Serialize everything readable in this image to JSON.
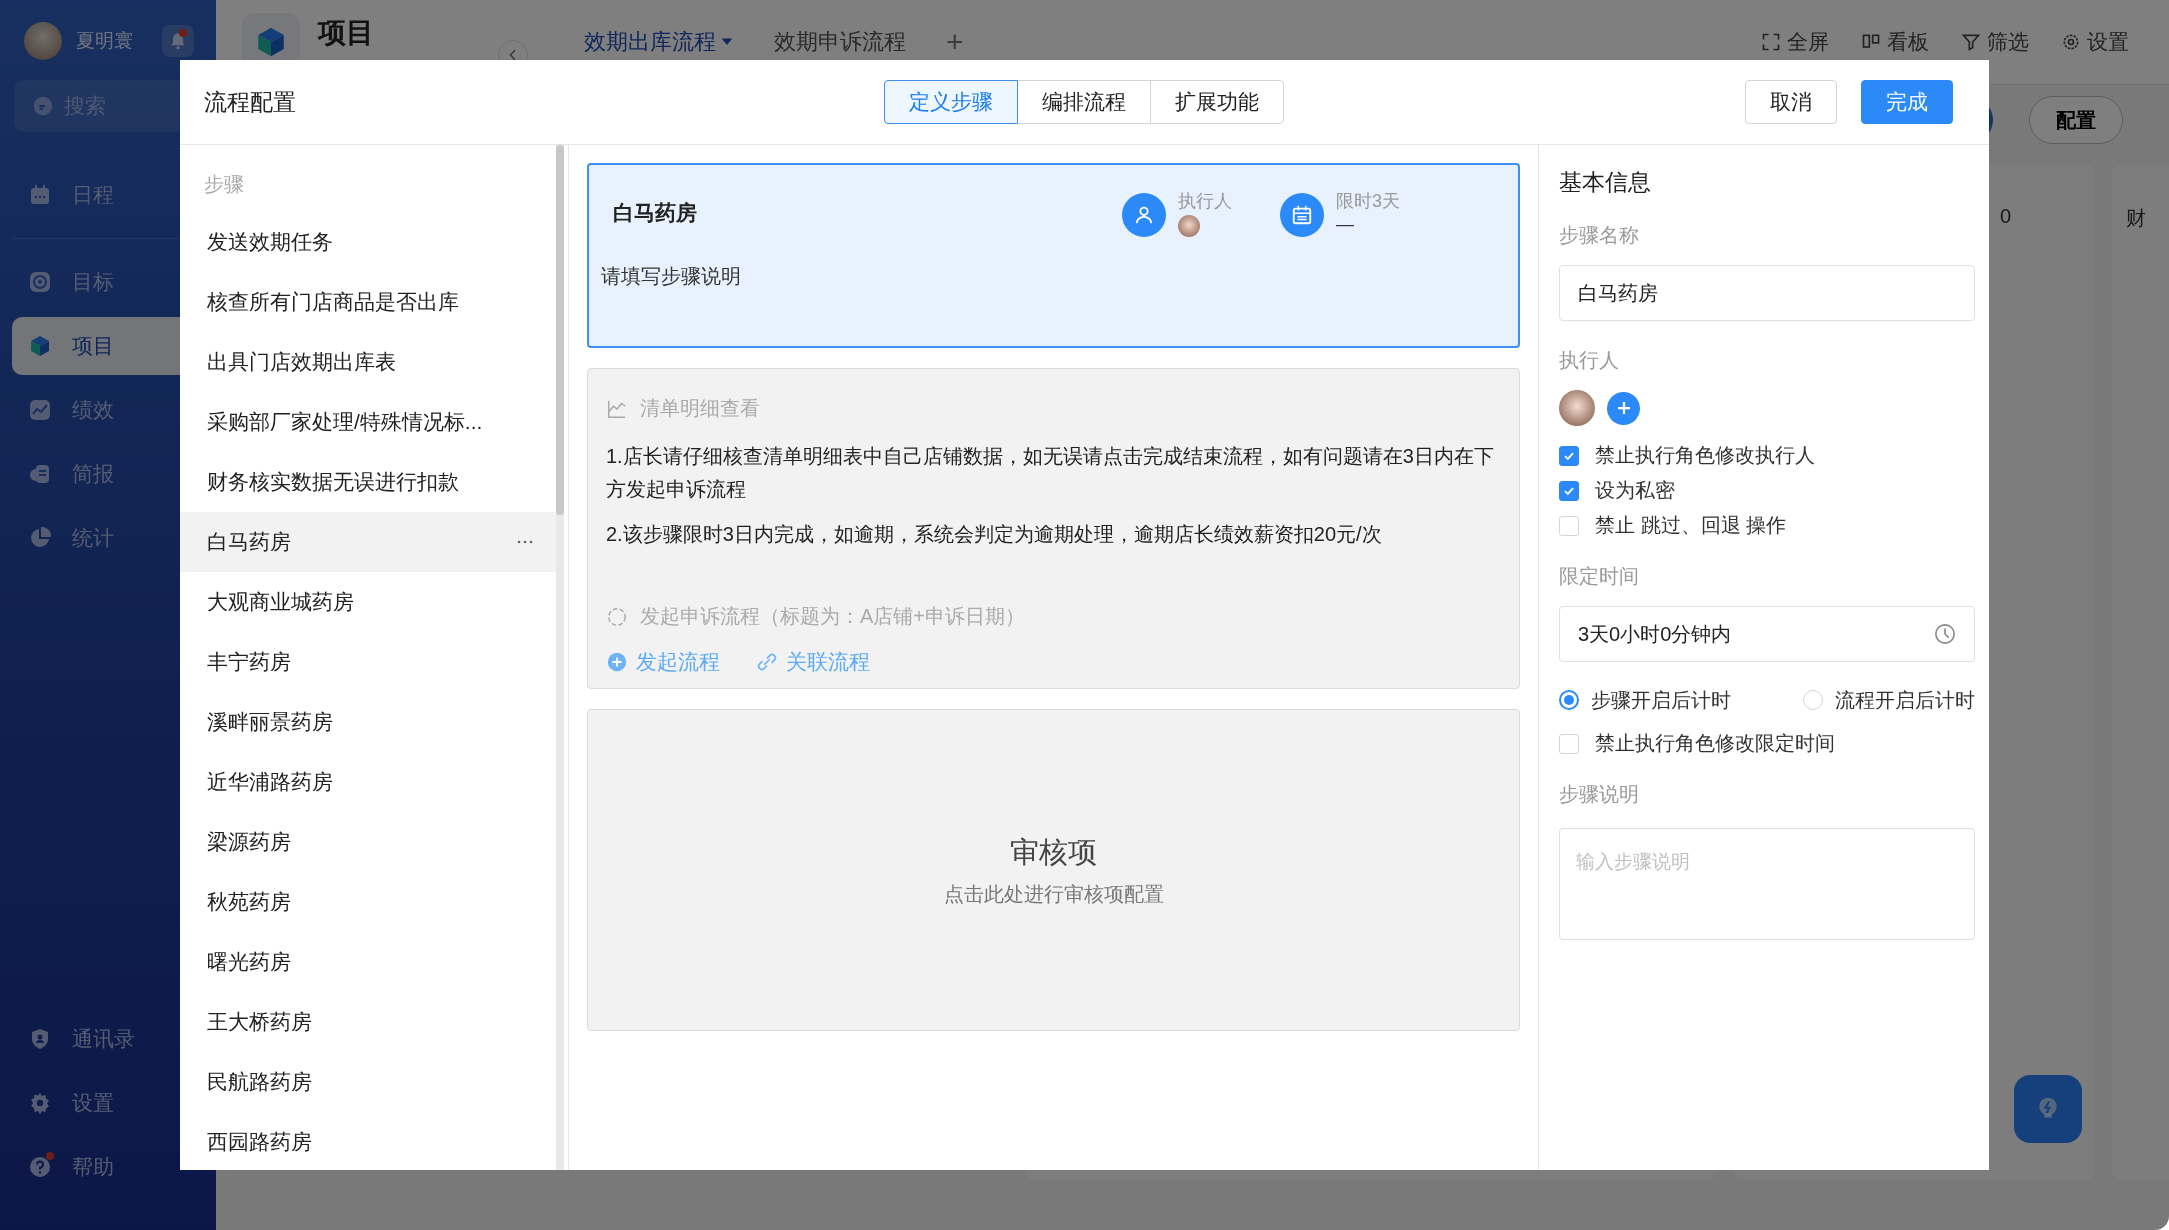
{
  "app": {
    "user": {
      "name": "夏明寰",
      "has_notification": true
    },
    "search": {
      "placeholder": "搜索"
    },
    "nav": [
      {
        "label": "日程",
        "selected": false
      },
      {
        "label": "目标",
        "selected": false
      },
      {
        "label": "项目",
        "selected": true
      },
      {
        "label": "绩效",
        "selected": false
      },
      {
        "label": "简报",
        "selected": false
      },
      {
        "label": "统计",
        "selected": false
      }
    ],
    "nav_bottom": [
      {
        "label": "通讯录"
      },
      {
        "label": "设置"
      },
      {
        "label": "帮助",
        "has_notification": true
      }
    ],
    "page_title": "项目",
    "flow_tabs": [
      {
        "label": "效期出库流程",
        "selected": true
      },
      {
        "label": "效期申诉流程",
        "selected": false
      }
    ],
    "add_tab": "+",
    "toolbar": [
      {
        "label": "全屏"
      },
      {
        "label": "看板"
      },
      {
        "label": "筛选"
      },
      {
        "label": "设置"
      }
    ],
    "config_button": "配置",
    "board_texts": [
      "0",
      "财"
    ]
  },
  "dialog": {
    "title": "流程配置",
    "tabs": [
      {
        "label": "定义步骤",
        "selected": true
      },
      {
        "label": "编排流程",
        "selected": false
      },
      {
        "label": "扩展功能",
        "selected": false
      }
    ],
    "cancel": "取消",
    "done": "完成",
    "steps": {
      "heading": "步骤",
      "items": [
        {
          "label": "发送效期任务",
          "selected": false
        },
        {
          "label": "核查所有门店商品是否出库",
          "selected": false
        },
        {
          "label": "出具门店效期出库表",
          "selected": false
        },
        {
          "label": "采购部厂家处理/特殊情况标...",
          "selected": false
        },
        {
          "label": "财务核实数据无误进行扣款",
          "selected": false
        },
        {
          "label": "白马药房",
          "selected": true
        },
        {
          "label": "大观商业城药房",
          "selected": false
        },
        {
          "label": "丰宁药房",
          "selected": false
        },
        {
          "label": "溪畔丽景药房",
          "selected": false
        },
        {
          "label": "近华浦路药房",
          "selected": false
        },
        {
          "label": "梁源药房",
          "selected": false
        },
        {
          "label": "秋苑药房",
          "selected": false
        },
        {
          "label": "曙光药房",
          "selected": false
        },
        {
          "label": "王大桥药房",
          "selected": false
        },
        {
          "label": "民航路药房",
          "selected": false
        },
        {
          "label": "西园路药房",
          "selected": false
        }
      ]
    },
    "step_card": {
      "title": "白马药房",
      "description": "请填写步骤说明",
      "assignee_label": "执行人",
      "time_label": "限时3天",
      "time_value": "—",
      "selected": true
    },
    "content_card": {
      "title": "清单明细查看",
      "paragraphs": [
        "1.店长请仔细核查清单明细表中自己店铺数据，如无误请点击完成结束流程，如有问题请在3日内在下方发起申诉流程",
        "2.该步骤限时3日内完成，如逾期，系统会判定为逾期处理，逾期店长绩效薪资扣20元/次"
      ],
      "appeal": "发起申诉流程（标题为：A店铺+申诉日期）",
      "links": [
        "发起流程",
        "关联流程"
      ]
    },
    "review_card": {
      "title": "审核项",
      "subtitle": "点击此处进行审核项配置"
    },
    "basic": {
      "heading": "基本信息",
      "name_label": "步骤名称",
      "name_value": "白马药房",
      "assignee_label": "执行人",
      "assignee_options": [
        {
          "label": "禁止执行角色修改执行人",
          "checked": true
        },
        {
          "label": "设为私密",
          "checked": true
        },
        {
          "label": "禁止 跳过、回退 操作",
          "checked": false
        }
      ],
      "time_label": "限定时间",
      "time_value": "3天0小时0分钟内",
      "timer_modes": [
        {
          "label": "步骤开启后计时",
          "selected": true
        },
        {
          "label": "流程开启后计时",
          "selected": false
        }
      ],
      "time_lock": {
        "label": "禁止执行角色修改限定时间",
        "checked": false
      },
      "desc_label": "步骤说明",
      "desc_placeholder": "输入步骤说明"
    }
  }
}
